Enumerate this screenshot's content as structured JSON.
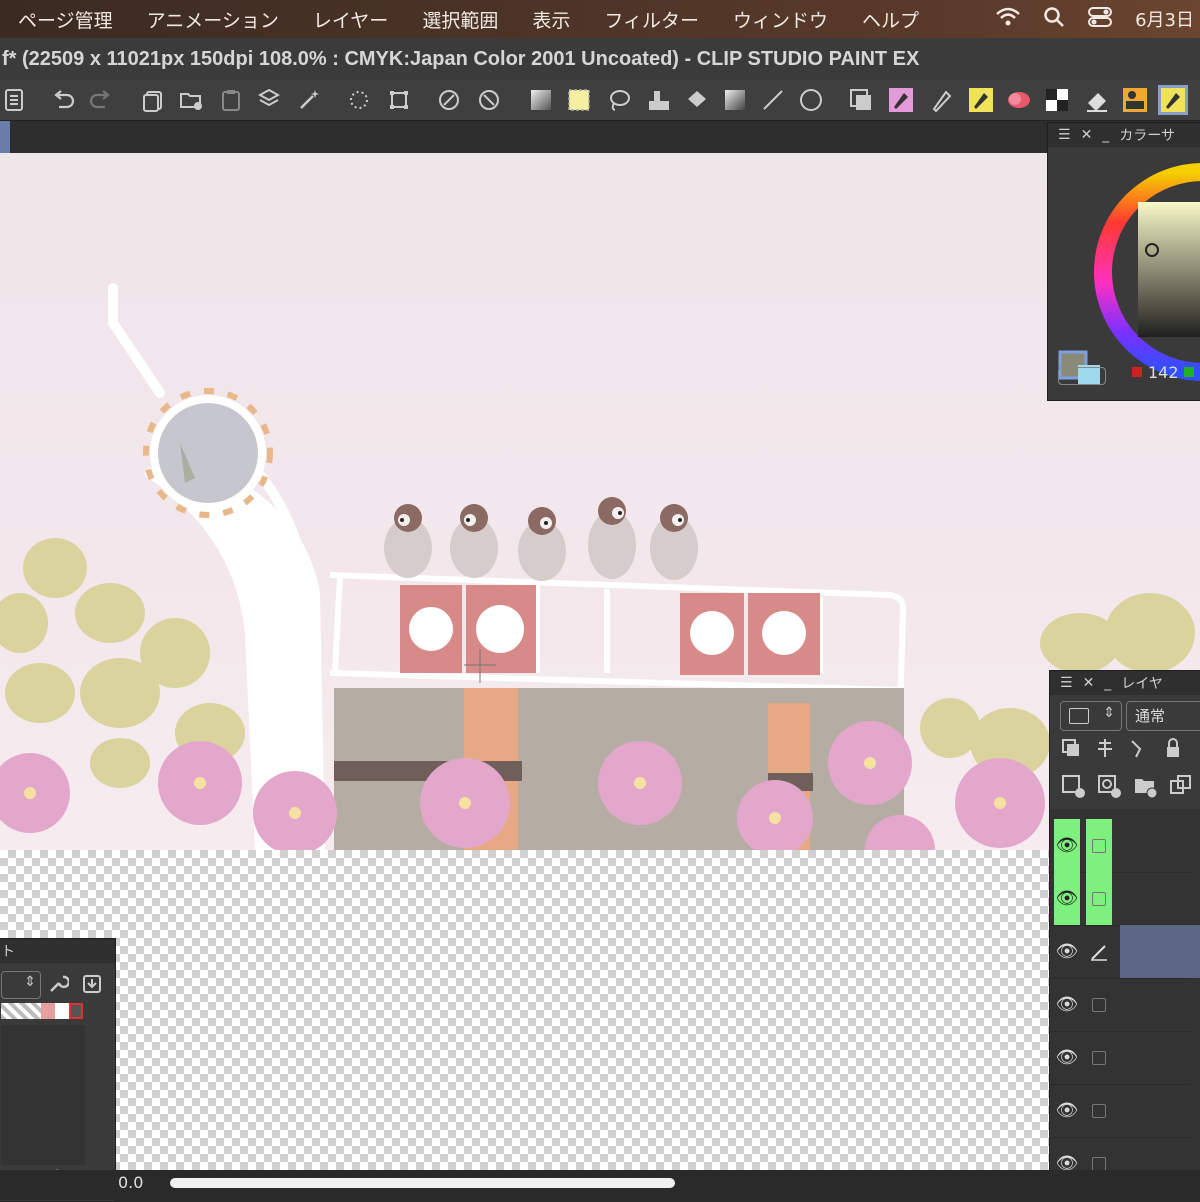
{
  "menubar": {
    "items": [
      "ページ管理",
      "アニメーション",
      "レイヤー",
      "選択範囲",
      "表示",
      "フィルター",
      "ウィンドウ",
      "ヘルプ"
    ],
    "date": "6月3日"
  },
  "window": {
    "title": "f* (22509 x 11021px 150dpi 108.0% : CMYK:Japan Color 2001 Uncoated)  - CLIP STUDIO PAINT EX"
  },
  "color_panel": {
    "title": "カラーサ",
    "value_r": "142"
  },
  "layer_panel": {
    "title": "レイヤ",
    "blend_mode": "通常"
  },
  "subtool_panel": {
    "title": "ト"
  },
  "status": {
    "zoom": "0.0"
  }
}
